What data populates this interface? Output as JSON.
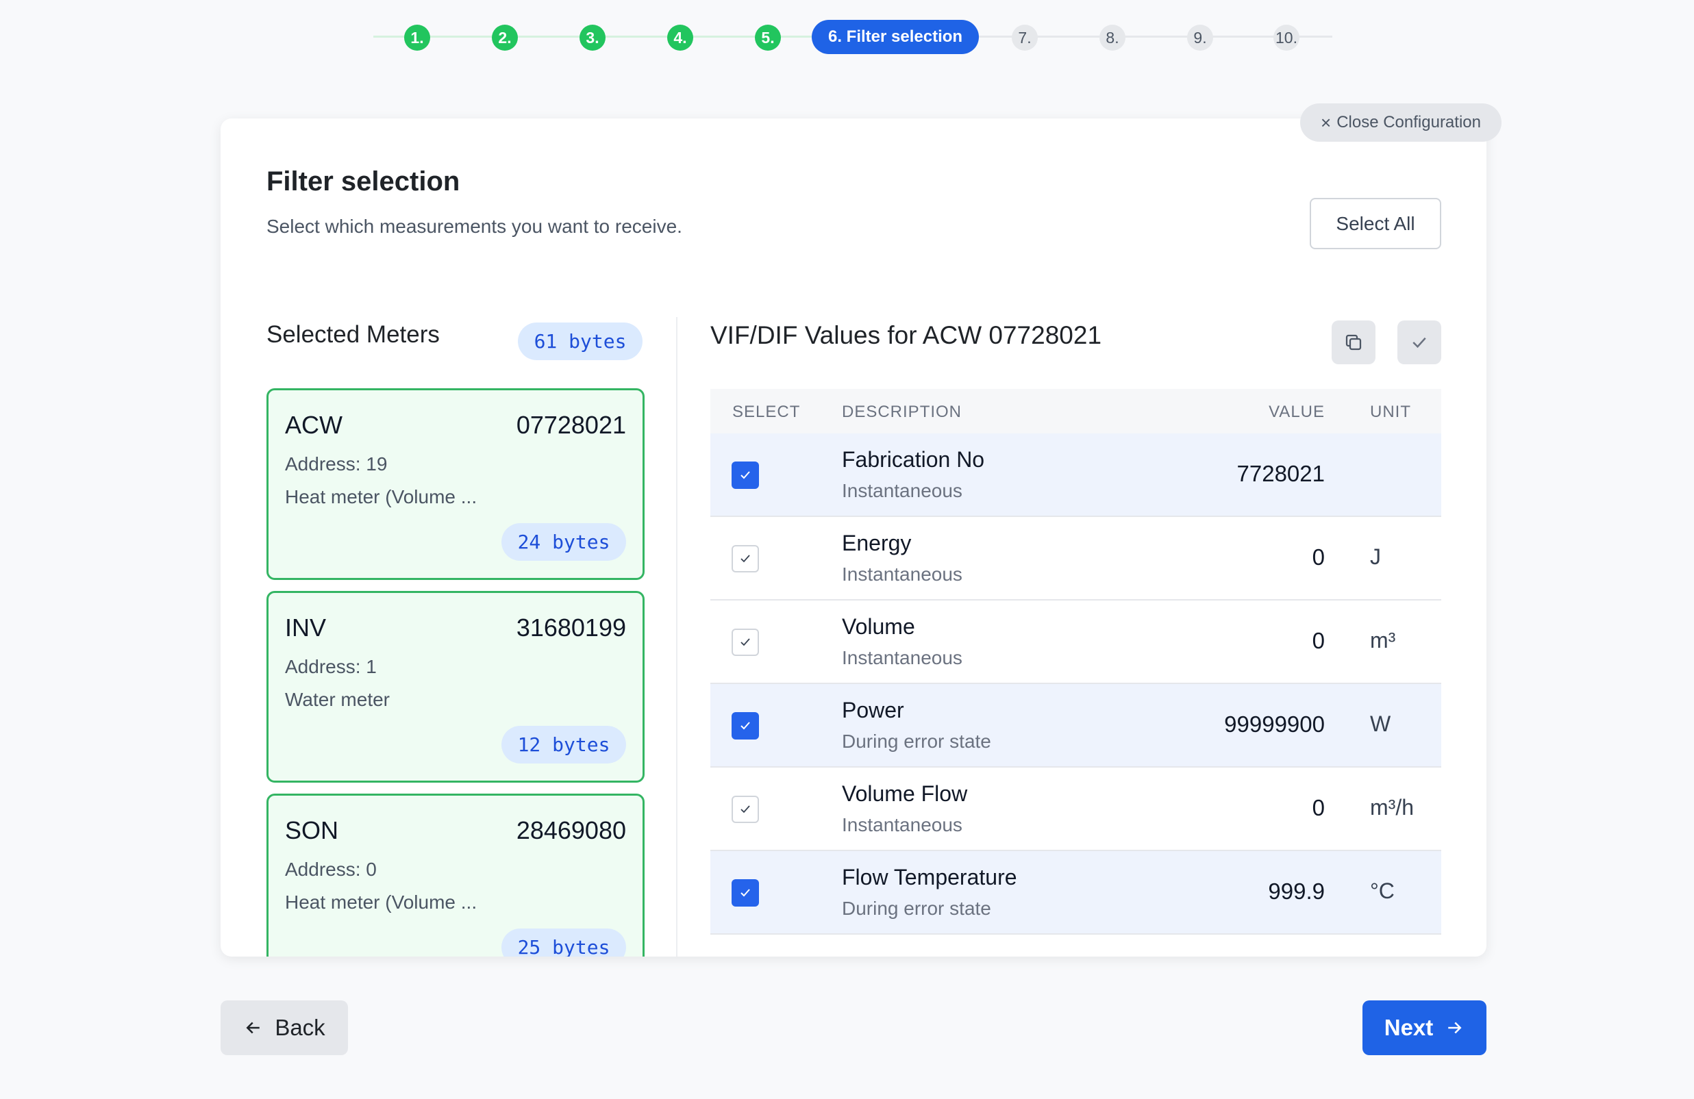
{
  "stepper": {
    "steps": [
      {
        "label": "1.",
        "state": "done"
      },
      {
        "label": "2.",
        "state": "done"
      },
      {
        "label": "3.",
        "state": "done"
      },
      {
        "label": "4.",
        "state": "done"
      },
      {
        "label": "5.",
        "state": "done"
      },
      {
        "label": "6. Filter selection",
        "state": "active"
      },
      {
        "label": "7.",
        "state": "todo"
      },
      {
        "label": "8.",
        "state": "todo"
      },
      {
        "label": "9.",
        "state": "todo"
      },
      {
        "label": "10.",
        "state": "todo"
      }
    ]
  },
  "close_config": {
    "icon": "close-icon",
    "label": "Close Configuration"
  },
  "page": {
    "title": "Filter selection",
    "subtitle": "Select which measurements you want to receive.",
    "select_all_label": "Select All"
  },
  "meters_panel": {
    "title": "Selected Meters",
    "total_bytes": "61 bytes",
    "meters": [
      {
        "name": "ACW",
        "serial": "07728021",
        "address": "Address: 19",
        "type": "Heat meter (Volume ...",
        "bytes": "24 bytes"
      },
      {
        "name": "INV",
        "serial": "31680199",
        "address": "Address: 1",
        "type": "Water meter",
        "bytes": "12 bytes"
      },
      {
        "name": "SON",
        "serial": "28469080",
        "address": "Address: 0",
        "type": "Heat meter (Volume ...",
        "bytes": "25 bytes"
      }
    ]
  },
  "values_panel": {
    "title": "VIF/DIF Values for ACW 07728021",
    "copy_icon": "copy-icon",
    "confirm_icon": "check-icon",
    "columns": {
      "select": "SELECT",
      "description": "DESCRIPTION",
      "value": "VALUE",
      "unit": "UNIT"
    },
    "rows": [
      {
        "description": "Fabrication No",
        "subtext": "Instantaneous",
        "value": "7728021",
        "unit": "",
        "checked": true
      },
      {
        "description": "Energy",
        "subtext": "Instantaneous",
        "value": "0",
        "unit": "J",
        "checked": false
      },
      {
        "description": "Volume",
        "subtext": "Instantaneous",
        "value": "0",
        "unit": "m³",
        "checked": false
      },
      {
        "description": "Power",
        "subtext": "During error state",
        "value": "99999900",
        "unit": "W",
        "checked": true
      },
      {
        "description": "Volume Flow",
        "subtext": "Instantaneous",
        "value": "0",
        "unit": "m³/h",
        "checked": false
      },
      {
        "description": "Flow Temperature",
        "subtext": "During error state",
        "value": "999.9",
        "unit": "°C",
        "checked": true
      }
    ]
  },
  "footer": {
    "back_label": "Back",
    "next_label": "Next"
  },
  "colors": {
    "primary": "#1f63e6",
    "success": "#22c55e",
    "meter_border": "#34b563",
    "meter_bg": "#effcf3"
  }
}
